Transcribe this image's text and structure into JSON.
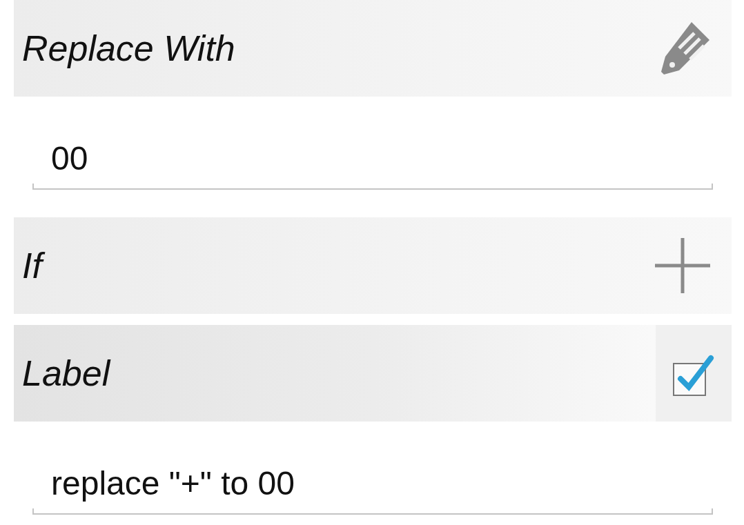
{
  "sections": [
    {
      "kind": "edit-header",
      "title": "Replace With"
    },
    {
      "kind": "field",
      "value": "00"
    },
    {
      "kind": "add-header",
      "title": "If"
    },
    {
      "kind": "check-header",
      "title": "Label",
      "checked": true
    },
    {
      "kind": "field",
      "value": "replace \"+\" to 00"
    }
  ]
}
